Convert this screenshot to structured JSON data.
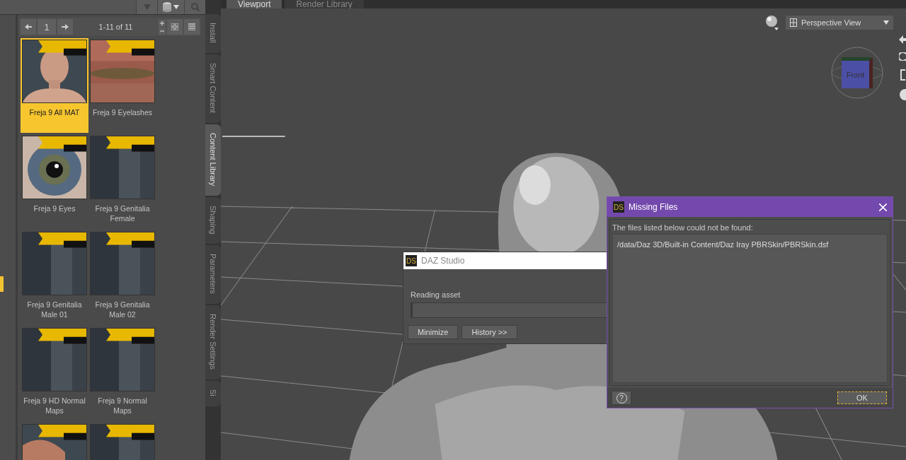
{
  "library": {
    "page": "1",
    "range": "1-11 of 11",
    "items": [
      {
        "kind": "picture",
        "label": "Freja 9 All MAT",
        "selected": true
      },
      {
        "kind": "picture",
        "label": "Freja 9 Eyelashes",
        "selected": false
      },
      {
        "kind": "picture",
        "label": "Freja 9 Eyes",
        "selected": false
      },
      {
        "kind": "picture",
        "label": "Freja 9 Genitalia Female",
        "selected": false
      },
      {
        "kind": "picture",
        "label": "Freja 9 Genitalia Male 01",
        "selected": false
      },
      {
        "kind": "picture",
        "label": "Freja 9 Genitalia Male 02",
        "selected": false
      },
      {
        "kind": "picture",
        "label": "Freja 9 HD Normal Maps",
        "selected": false
      },
      {
        "kind": "picture",
        "label": "Freja 9 Normal Maps",
        "selected": false
      },
      {
        "kind": "picture",
        "selected": false
      },
      {
        "kind": "picture",
        "selected": false
      }
    ]
  },
  "side_tabs": [
    {
      "label": "Install",
      "selected": false
    },
    {
      "label": "Smart Content",
      "selected": false
    },
    {
      "label": "Content Library",
      "selected": true
    },
    {
      "label": "Shaping",
      "selected": false
    },
    {
      "label": "Parameters",
      "selected": false
    },
    {
      "label": "Render Settings",
      "selected": false
    },
    {
      "label": "Si",
      "selected": false
    }
  ],
  "viewport_tabs": [
    {
      "label": "Viewport",
      "selected": true
    },
    {
      "label": "Render Library",
      "selected": false
    }
  ],
  "view_menu": {
    "value": "Perspective View"
  },
  "view_cube": {
    "face": "Front"
  },
  "progress_dialog": {
    "logo": "DS",
    "title": "DAZ Studio",
    "message": "Reading asset",
    "level": 0,
    "buttons": [
      "Minimize",
      "History >>"
    ]
  },
  "missing_dialog": {
    "logo": "DS",
    "title": "Missing Files",
    "message": "The files listed below could not be found:",
    "files": [
      "/data/Daz 3D/Built-in Content/Daz Iray PBRSkin/PBRSkin.dsf"
    ],
    "help": "?",
    "buttons": [
      "OK"
    ]
  }
}
